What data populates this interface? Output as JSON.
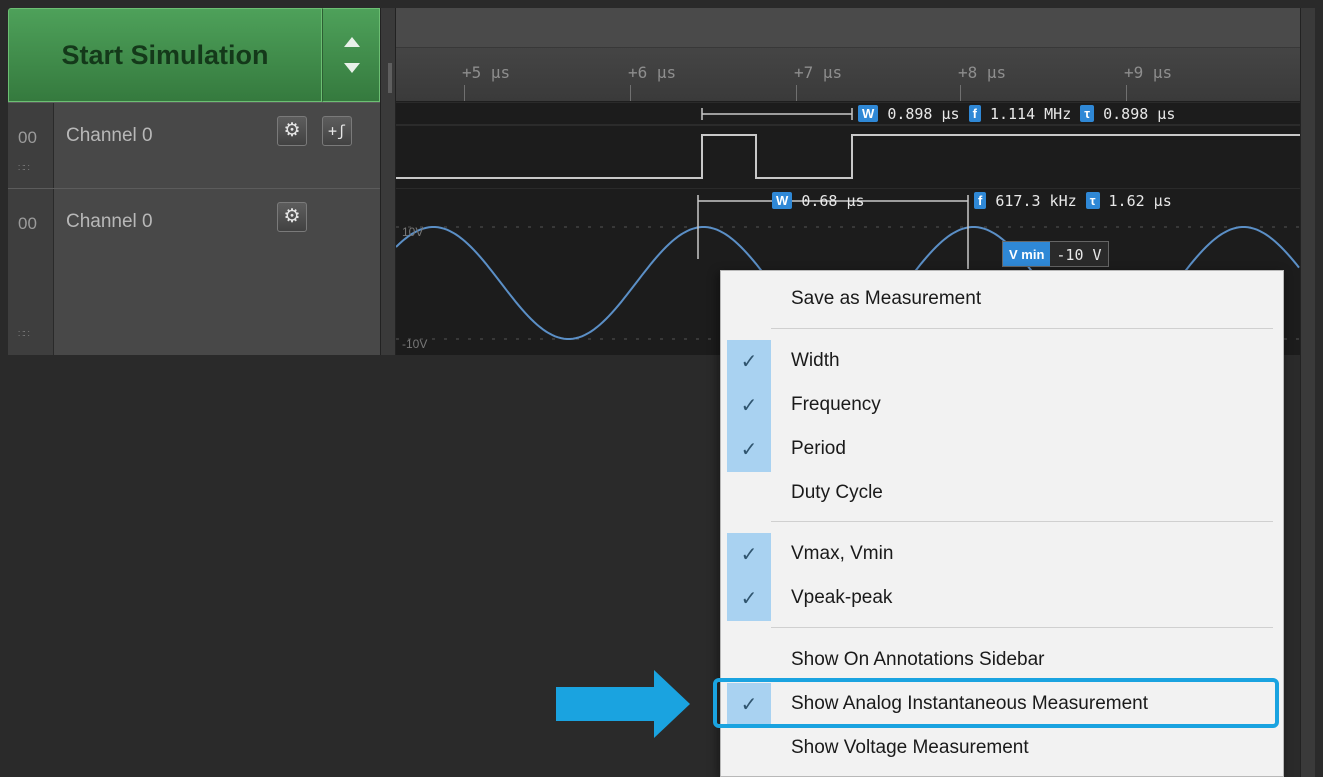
{
  "toolbar": {
    "start_label": "Start Simulation"
  },
  "timeline": {
    "ticks": [
      "+5 µs",
      "+6 µs",
      "+7 µs",
      "+8 µs",
      "+9 µs"
    ]
  },
  "channels": [
    {
      "index": "00",
      "name": "Channel 0"
    },
    {
      "index": "00",
      "name": "Channel 0"
    }
  ],
  "digital_measurement": {
    "width_value": "0.898 µs",
    "freq_value": "1.114 MHz",
    "period_value": "0.898 µs"
  },
  "analog_measurement": {
    "width_value": "0.68 µs",
    "freq_value": "617.3 kHz",
    "period_value": "1.62 µs",
    "vmax_label": "10V",
    "vmin_label": "-10V",
    "vmin_key": "V min",
    "vmin_value": "-10 V"
  },
  "badges": {
    "width": "W",
    "freq": "f",
    "period": "τ"
  },
  "context_menu": {
    "items": [
      {
        "label": "Save as Measurement",
        "checked": false
      },
      {
        "label": "Width",
        "checked": true
      },
      {
        "label": "Frequency",
        "checked": true
      },
      {
        "label": "Period",
        "checked": true
      },
      {
        "label": "Duty Cycle",
        "checked": false
      },
      {
        "label": "Vmax, Vmin",
        "checked": true
      },
      {
        "label": "Vpeak-peak",
        "checked": true
      },
      {
        "label": "Show On Annotations Sidebar",
        "checked": false
      },
      {
        "label": "Show Analog Instantaneous Measurement",
        "checked": true
      },
      {
        "label": "Show Voltage Measurement",
        "checked": false
      }
    ],
    "check_glyph": "✓"
  },
  "colors": {
    "accent_green": "#4ea15a",
    "waveform_blue": "#5b8fc6",
    "badge_blue": "#2f88d6",
    "highlight_cyan": "#1aa3e0"
  }
}
